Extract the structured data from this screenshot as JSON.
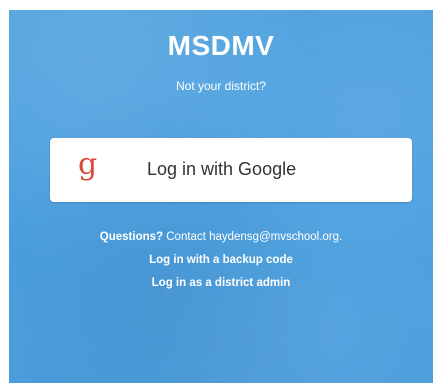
{
  "district": {
    "name": "MSDMV",
    "not_your_district": "Not your district?"
  },
  "login": {
    "google_icon": "g",
    "google_label": "Log in with Google"
  },
  "help": {
    "questions_label": "Questions?",
    "contact_text": "Contact haydensg@mvschool.org."
  },
  "links": {
    "backup_code": "Log in with a backup code",
    "district_admin": "Log in as a district admin"
  },
  "colors": {
    "background_blue": "#4a9fe0",
    "google_red": "#d94a38",
    "button_white": "#ffffff"
  }
}
